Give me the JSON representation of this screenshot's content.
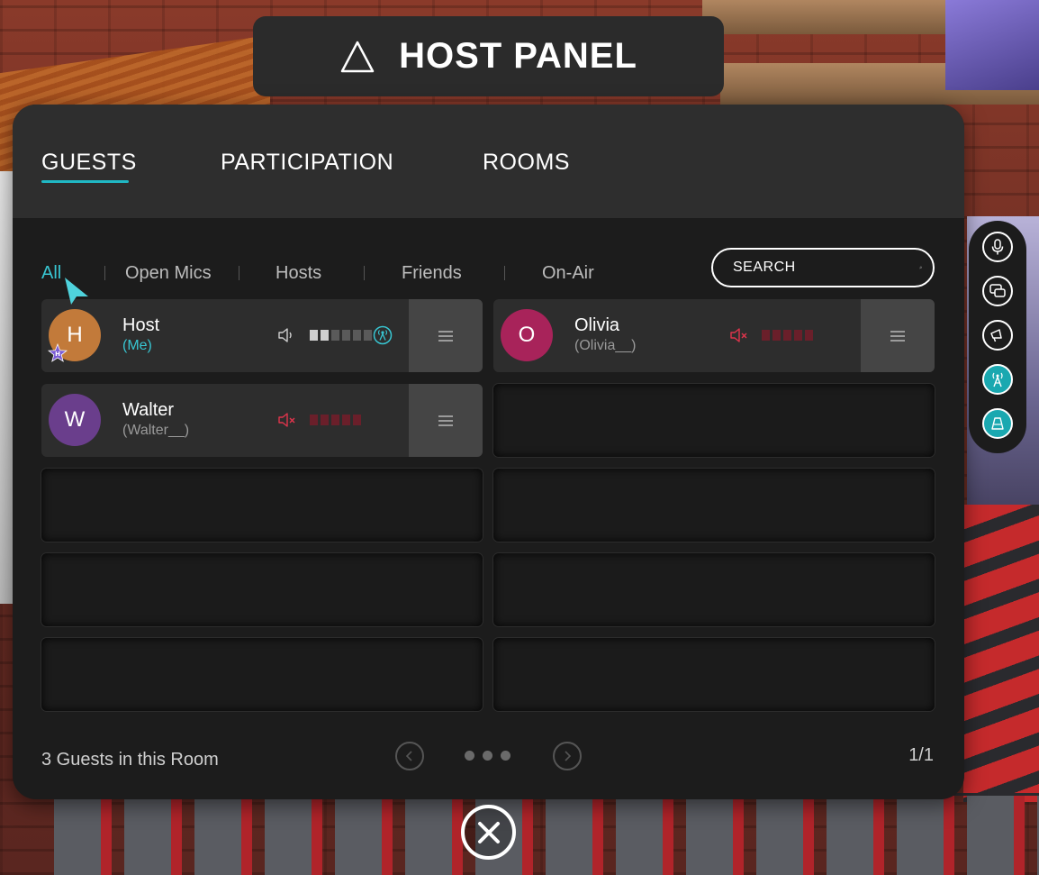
{
  "header": {
    "title": "HOST PANEL",
    "icon": "triangle-icon"
  },
  "tabs": [
    {
      "label": "GUESTS",
      "active": true
    },
    {
      "label": "PARTICIPATION",
      "active": false
    },
    {
      "label": "ROOMS",
      "active": false
    }
  ],
  "filters": [
    {
      "label": "All",
      "active": true
    },
    {
      "label": "Open Mics",
      "active": false
    },
    {
      "label": "Hosts",
      "active": false
    },
    {
      "label": "Friends",
      "active": false
    },
    {
      "label": "On-Air",
      "active": false
    }
  ],
  "search": {
    "placeholder": "SEARCH"
  },
  "guests": [
    {
      "initial": "H",
      "name": "Host",
      "handle": "(Me)",
      "avatar_color": "#c27a3a",
      "is_host": true,
      "badge_letter": "H",
      "muted": false,
      "level": 2,
      "on_air": true
    },
    {
      "initial": "O",
      "name": "Olivia",
      "handle": "(Olivia__)",
      "avatar_color": "#a8235a",
      "is_host": false,
      "muted": true,
      "level": 0,
      "on_air": false
    },
    {
      "initial": "W",
      "name": "Walter",
      "handle": "(Walter__)",
      "avatar_color": "#6a3e8c",
      "is_host": false,
      "muted": true,
      "level": 0,
      "on_air": false
    }
  ],
  "footer": {
    "count_text": "3 Guests in this Room",
    "page": "1/1"
  },
  "side_toolbar": [
    "microphone-icon",
    "chat-icon",
    "megaphone-icon",
    "broadcast-tower-icon",
    "stage-icon"
  ],
  "colors": {
    "accent": "#38c6d2",
    "muted": "#e0344c",
    "panel": "#1c1c1c",
    "tabbar": "#2e2e2e"
  }
}
